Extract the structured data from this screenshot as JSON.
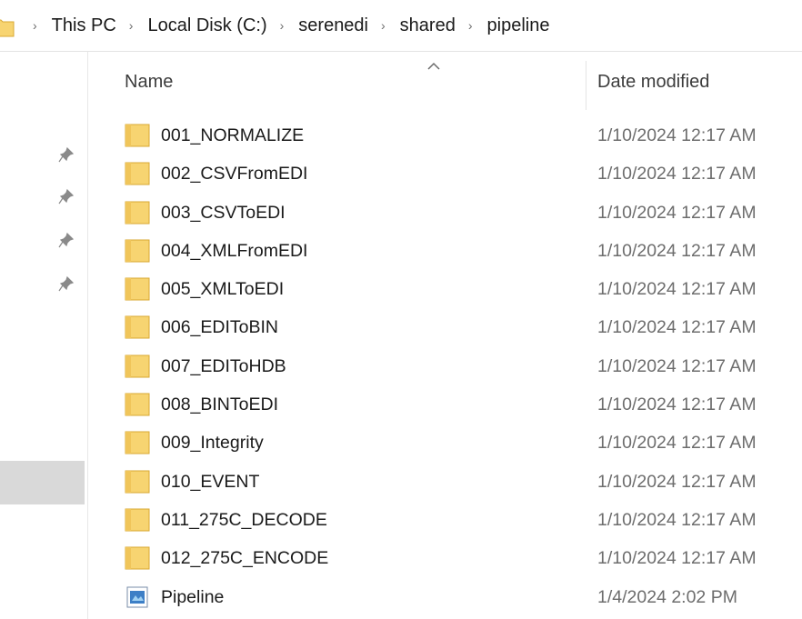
{
  "breadcrumb": {
    "items": [
      "This PC",
      "Local Disk (C:)",
      "serenedi",
      "shared",
      "pipeline"
    ]
  },
  "columns": {
    "name": "Name",
    "date_modified": "Date modified"
  },
  "colors": {
    "folder": "#f7d471",
    "folder_border": "#d9a832",
    "nav_selected": "#d9d9d9"
  },
  "files": [
    {
      "name": "001_NORMALIZE",
      "date": "1/10/2024 12:17 AM",
      "icon": "folder-icon"
    },
    {
      "name": "002_CSVFromEDI",
      "date": "1/10/2024 12:17 AM",
      "icon": "folder-icon"
    },
    {
      "name": "003_CSVToEDI",
      "date": "1/10/2024 12:17 AM",
      "icon": "folder-icon"
    },
    {
      "name": "004_XMLFromEDI",
      "date": "1/10/2024 12:17 AM",
      "icon": "folder-icon"
    },
    {
      "name": "005_XMLToEDI",
      "date": "1/10/2024 12:17 AM",
      "icon": "folder-icon"
    },
    {
      "name": "006_EDIToBIN",
      "date": "1/10/2024 12:17 AM",
      "icon": "folder-icon"
    },
    {
      "name": "007_EDIToHDB",
      "date": "1/10/2024 12:17 AM",
      "icon": "folder-icon"
    },
    {
      "name": "008_BINToEDI",
      "date": "1/10/2024 12:17 AM",
      "icon": "folder-icon"
    },
    {
      "name": "009_Integrity",
      "date": "1/10/2024 12:17 AM",
      "icon": "folder-icon"
    },
    {
      "name": "010_EVENT",
      "date": "1/10/2024 12:17 AM",
      "icon": "folder-icon"
    },
    {
      "name": "011_275C_DECODE",
      "date": "1/10/2024 12:17 AM",
      "icon": "folder-icon"
    },
    {
      "name": "012_275C_ENCODE",
      "date": "1/10/2024 12:17 AM",
      "icon": "folder-icon"
    },
    {
      "name": "Pipeline",
      "date": "1/4/2024 2:02 PM",
      "icon": "diagram-file-icon"
    }
  ]
}
